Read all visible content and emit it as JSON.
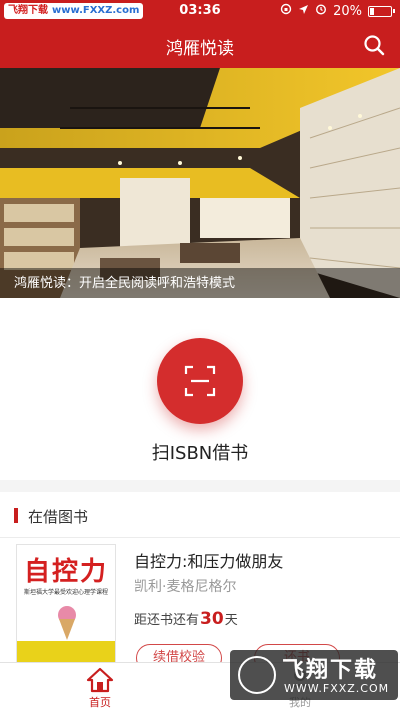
{
  "status_bar": {
    "watermark_left": "飞翔下载",
    "watermark_right": "www.FXXZ.com",
    "time": "03:36",
    "battery": "20%",
    "battery_level": 0.2
  },
  "header": {
    "title": "鸿雁悦读"
  },
  "banner": {
    "caption": "鸿雁悦读：开启全民阅读呼和浩特模式"
  },
  "scan": {
    "label": "扫ISBN借书"
  },
  "borrowed": {
    "section_title": "在借图书",
    "book": {
      "cover_title": "自控力",
      "cover_subtitle": "斯坦福大学最受欢迎心理学课程",
      "title": "自控力:和压力做朋友",
      "author": "凯利·麦格尼格尔",
      "due_prefix": "距还书还有",
      "due_days": "30",
      "due_suffix": "天",
      "button_renew": "续借校验",
      "button_other": "还书"
    }
  },
  "tabbar": {
    "home": "首页",
    "mine": "我的"
  },
  "overlay_watermark": {
    "big": "飞翔下载",
    "small": "WWW.FXXZ.COM"
  },
  "colors": {
    "brand_red": "#c81e1e",
    "scan_red": "#d42d2d"
  }
}
